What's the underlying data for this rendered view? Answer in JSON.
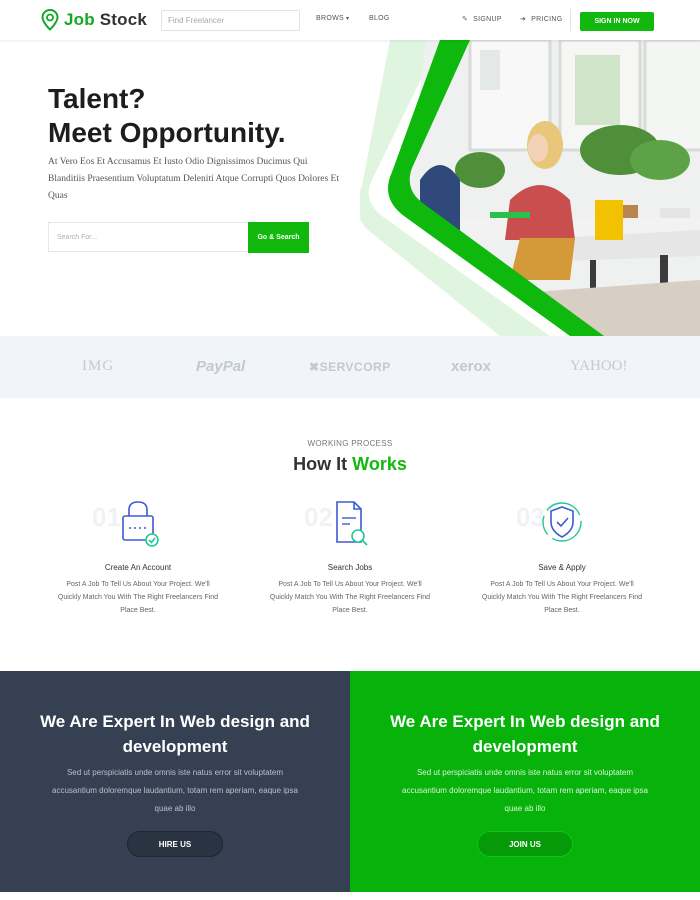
{
  "nav": {
    "logo_brand": "Job",
    "logo_brand_second": "Stock",
    "search_placeholder": "Find Freelancer",
    "browse": "BROWS",
    "blog": "BLOG",
    "signup": "SIGNUP",
    "pricing": "PRICING",
    "signin": "SIGN IN NOW"
  },
  "hero": {
    "title_line1": "Talent?",
    "title_line2": "Meet Opportunity.",
    "description": "At Vero Eos Et Accusamus Et Iusto Odio Dignissimos Ducimus Qui Blanditiis Praesentium Voluptatum Deleniti Atque Corrupti Quos Dolores Et Quas",
    "search_placeholder": "Search For...",
    "search_button": "Go & Search"
  },
  "brands": [
    "IMG",
    "PayPal",
    "SERVCORP",
    "xerox",
    "YAHOO!"
  ],
  "how": {
    "eyebrow": "WORKING PROCESS",
    "title_part1": "How It",
    "title_part2": "Works",
    "steps": [
      {
        "num": "01",
        "title": "Create An Account",
        "desc": "Post A Job To Tell Us About Your Project. We'll Quickly Match You With The Right Freelancers Find Place Best.",
        "icon": "lock-check-icon"
      },
      {
        "num": "02",
        "title": "Search Jobs",
        "desc": "Post A Job To Tell Us About Your Project. We'll Quickly Match You With The Right Freelancers Find Place Best.",
        "icon": "document-search-icon"
      },
      {
        "num": "03",
        "title": "Save & Apply",
        "desc": "Post A Job To Tell Us About Your Project. We'll Quickly Match You With The Right Freelancers Find Place Best.",
        "icon": "shield-check-icon"
      }
    ]
  },
  "cta": {
    "left": {
      "title": "We Are Expert In Web design and development",
      "desc": "Sed ut perspiciatis unde omnis iste natus error sit voluptatem accusantium doloremque laudantium, totam rem aperiam, eaque ipsa quae ab illo",
      "button": "HIRE US"
    },
    "right": {
      "title": "We Are Expert In Web design and development",
      "desc": "Sed ut perspiciatis unde omnis iste natus error sit voluptatem accusantium doloremque laudantium, totam rem aperiam, eaque ipsa quae ab illo",
      "button": "JOIN US"
    }
  },
  "colors": {
    "accent": "#13b80f",
    "dark_panel": "#354052",
    "green_panel": "#07b20a"
  }
}
